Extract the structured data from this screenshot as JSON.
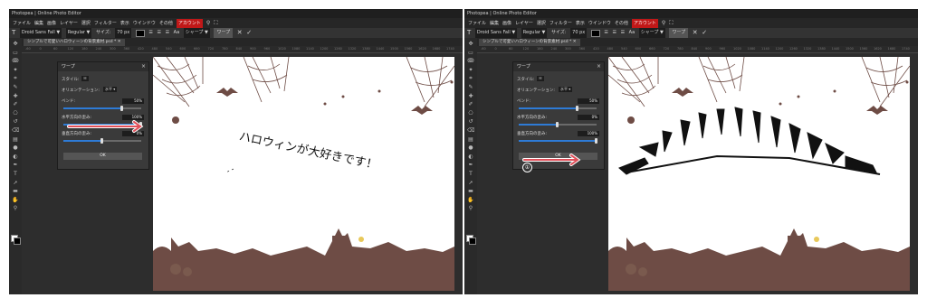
{
  "app": {
    "title": "Photopea | Online Photo Editor",
    "menu": [
      "ファイル",
      "編集",
      "画像",
      "レイヤー",
      "選択",
      "フィルター",
      "表示",
      "ウインドウ",
      "その他"
    ],
    "account": "アカウント",
    "menu_icons": [
      "search-icon",
      "fullscreen-icon"
    ]
  },
  "options": {
    "font": "Droid Sans Fall ▼",
    "style": "Regular ▼",
    "size_label": "サイズ:",
    "size_value": "70 px",
    "aa_label": "Aa",
    "aa_value": "シャープ ▼",
    "warp_button": "ワープ",
    "cancel": "✕",
    "confirm": "✓"
  },
  "document": {
    "tab_title": "シンプルで可愛いハロウィーンの背景素材.psd *",
    "tab_close": "✕",
    "ruler_ticks": [
      "-60",
      "0",
      "60",
      "120",
      "180",
      "240",
      "300",
      "360",
      "420",
      "480",
      "540",
      "600",
      "660",
      "720",
      "780",
      "840",
      "900",
      "960",
      "1020",
      "1080",
      "1140",
      "1200",
      "1260",
      "1320",
      "1380",
      "1440",
      "1500",
      "1560",
      "1620",
      "1680",
      "1740"
    ]
  },
  "tools": [
    "move-tool-icon",
    "marquee-tool-icon",
    "lasso-tool-icon",
    "wand-tool-icon",
    "crop-tool-icon",
    "eyedropper-tool-icon",
    "heal-tool-icon",
    "brush-tool-icon",
    "stamp-tool-icon",
    "history-brush-icon",
    "eraser-tool-icon",
    "gradient-tool-icon",
    "blur-tool-icon",
    "dodge-tool-icon",
    "pen-tool-icon",
    "type-tool-icon",
    "path-select-icon",
    "shape-tool-icon",
    "hand-tool-icon",
    "zoom-tool-icon"
  ],
  "colors": {
    "accent": "#2e7bd6",
    "account": "#c01818",
    "arrow": "#e0505a",
    "decor": "#6e4c45"
  },
  "warp_left": {
    "title": "ワープ",
    "close": "×",
    "style_label": "スタイル:",
    "style_value": "☵",
    "orientation_label": "オリエンテーション:",
    "orientation_value": "水平 ▾",
    "bend_label": "ベンド:",
    "bend_value": "50%",
    "bend_level": 0.75,
    "hdist_label": "水平方向の歪み:",
    "hdist_value": "100%",
    "hdist_level": 1.0,
    "vdist_label": "垂直方向の歪み:",
    "vdist_value": "0%",
    "vdist_level": 0.5,
    "ok": "OK"
  },
  "warp_right": {
    "title": "ワープ",
    "close": "×",
    "style_label": "スタイル:",
    "style_value": "☵",
    "orientation_label": "オリエンテーション:",
    "orientation_value": "水平 ▾",
    "bend_label": "ベンド:",
    "bend_value": "50%",
    "bend_level": 0.75,
    "hdist_label": "水平方向の歪み:",
    "hdist_value": "0%",
    "hdist_level": 0.5,
    "vdist_label": "垂直方向の歪み:",
    "vdist_value": "100%",
    "vdist_level": 1.0,
    "ok": "OK",
    "annotation": "①"
  },
  "canvas_text": "ハロウィンが大好きです！"
}
